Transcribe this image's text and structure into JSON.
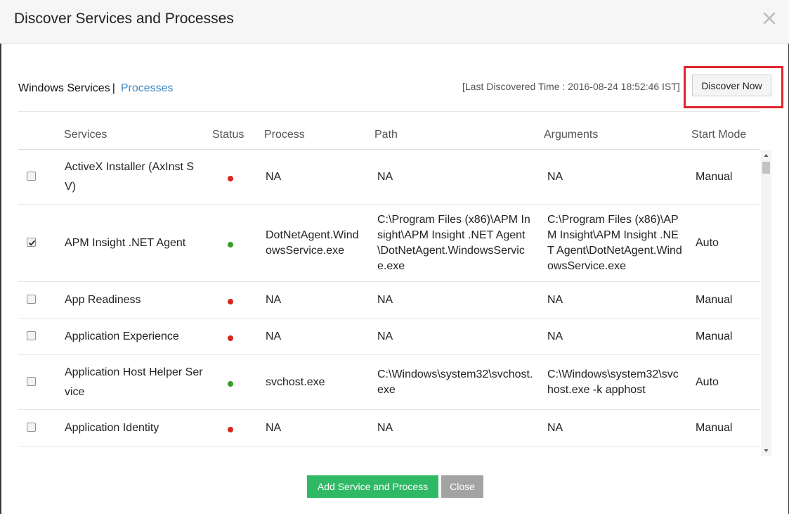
{
  "dialog": {
    "title": "Discover Services and Processes"
  },
  "tabs": {
    "active": "Windows Services",
    "separator": "|",
    "other": "Processes"
  },
  "discovery": {
    "last_time_text": "[Last Discovered Time : 2016-08-24 18:52:46 IST]",
    "button_label": "Discover Now"
  },
  "table": {
    "headers": {
      "services": "Services",
      "status": "Status",
      "process": "Process",
      "path": "Path",
      "arguments": "Arguments",
      "start_mode": "Start Mode"
    },
    "rows": [
      {
        "service": "ActiveX Installer (AxInst SV)",
        "status": "down",
        "process": "NA",
        "path": "NA",
        "arguments": "NA",
        "start_mode": "Manual",
        "checked": false
      },
      {
        "service": "APM Insight .NET Agent",
        "status": "up",
        "process": "DotNetAgent.WindowsService.exe",
        "path": "C:\\Program Files (x86)\\APM Insight\\APM Insight .NET Agent\\DotNetAgent.WindowsService.exe",
        "arguments": "C:\\Program Files (x86)\\APM Insight\\APM Insight .NET Agent\\DotNetAgent.WindowsService.exe",
        "start_mode": "Auto",
        "checked": true
      },
      {
        "service": "App Readiness",
        "status": "down",
        "process": "NA",
        "path": "NA",
        "arguments": "NA",
        "start_mode": "Manual",
        "checked": false
      },
      {
        "service": "Application Experience",
        "status": "down",
        "process": "NA",
        "path": "NA",
        "arguments": "NA",
        "start_mode": "Manual",
        "checked": false
      },
      {
        "service": "Application Host Helper Service",
        "status": "up",
        "process": "svchost.exe",
        "path": "C:\\Windows\\system32\\svchost.exe",
        "arguments": "C:\\Windows\\system32\\svchost.exe -k apphost",
        "start_mode": "Auto",
        "checked": false
      },
      {
        "service": "Application Identity",
        "status": "down",
        "process": "NA",
        "path": "NA",
        "arguments": "NA",
        "start_mode": "Manual",
        "checked": false
      }
    ]
  },
  "buttons": {
    "add": "Add Service and Process",
    "close": "Close"
  },
  "colors": {
    "status_up": "#3a9c2a",
    "status_down": "#d9261c",
    "link": "#3d8bc6",
    "highlight": "#e0242e",
    "primary_button": "#2fb965",
    "secondary_button": "#a3a3a3"
  },
  "icons": {
    "close": "close-icon",
    "checkbox_checked": "checkmark-icon",
    "scroll_up": "triangle-up-icon",
    "scroll_down": "triangle-down-icon"
  }
}
